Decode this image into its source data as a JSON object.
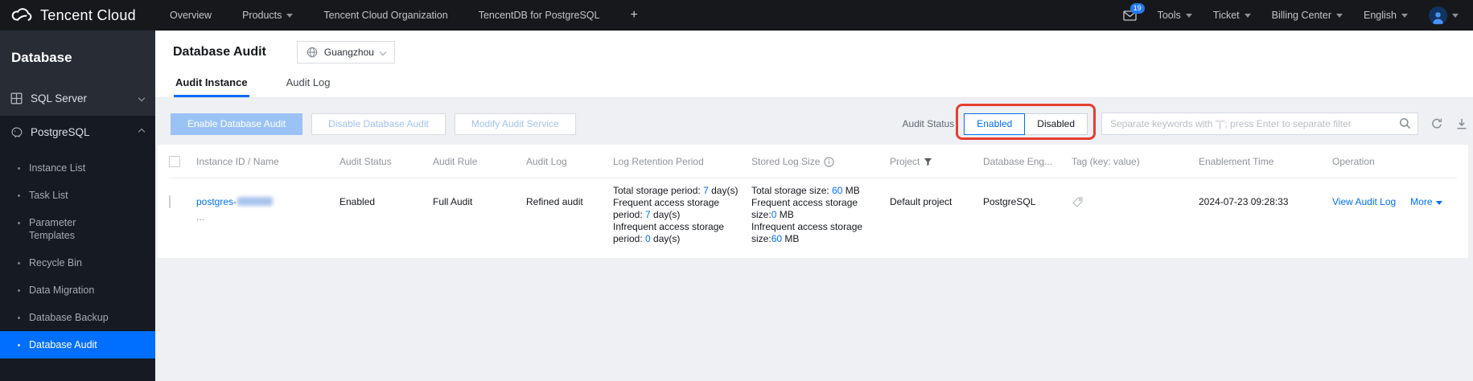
{
  "topbar": {
    "brand": "Tencent Cloud",
    "nav": [
      {
        "label": "Overview",
        "arrow": false
      },
      {
        "label": "Products",
        "arrow": true
      },
      {
        "label": "Tencent Cloud Organization",
        "arrow": false
      },
      {
        "label": "TencentDB for PostgreSQL",
        "arrow": false
      },
      {
        "label": "+",
        "arrow": false
      }
    ],
    "mail_badge": "19",
    "right_nav": [
      {
        "label": "Tools",
        "arrow": true
      },
      {
        "label": "Ticket",
        "arrow": true
      },
      {
        "label": "Billing Center",
        "arrow": true
      },
      {
        "label": "English",
        "arrow": true
      }
    ]
  },
  "sidebar": {
    "title": "Database",
    "groups": [
      {
        "label": "SQL Server"
      },
      {
        "label": "PostgreSQL"
      }
    ],
    "items": [
      {
        "label": "Instance List"
      },
      {
        "label": "Task List"
      },
      {
        "label": "Parameter Templates"
      },
      {
        "label": "Recycle Bin"
      },
      {
        "label": "Data Migration"
      },
      {
        "label": "Database Backup"
      },
      {
        "label": "Database Audit"
      }
    ],
    "selected_item": "Database Audit"
  },
  "page": {
    "title": "Database Audit",
    "region": "Guangzhou",
    "tabs": [
      {
        "label": "Audit Instance"
      },
      {
        "label": "Audit Log"
      }
    ]
  },
  "toolbar": {
    "enable_button": "Enable Database Audit",
    "disable_button": "Disable Database Audit",
    "modify_button": "Modify Audit Service",
    "audit_status_label": "Audit Status",
    "status_enabled": "Enabled",
    "status_disabled": "Disabled",
    "search_placeholder": "Separate keywords with \"|\"; press Enter to separate filter"
  },
  "table": {
    "columns": [
      "Instance ID / Name",
      "Audit Status",
      "Audit Rule",
      "Audit Log",
      "Log Retention Period",
      "Stored Log Size",
      "Project",
      "Database Eng...",
      "Tag (key: value)",
      "Enablement Time",
      "Operation"
    ],
    "row": {
      "instance_id": "postgres-",
      "instance_name": "...",
      "audit_status": "Enabled",
      "audit_rule": "Full Audit",
      "audit_log": "Refined audit",
      "log_retention_lines": [
        [
          {
            "t": "Total storage period: "
          },
          {
            "t": "7",
            "hl": true
          },
          {
            "t": " day(s)"
          }
        ],
        [
          {
            "t": "Frequent access storage period: "
          },
          {
            "t": "7",
            "hl": true
          },
          {
            "t": " day(s)"
          }
        ],
        [
          {
            "t": "Infrequent access storage period: "
          },
          {
            "t": "0",
            "hl": true
          },
          {
            "t": " day(s)"
          }
        ]
      ],
      "stored_log_lines": [
        [
          {
            "t": "Total storage size: "
          },
          {
            "t": "60",
            "hl": true
          },
          {
            "t": " MB"
          }
        ],
        [
          {
            "t": "Frequent access storage size:"
          },
          {
            "t": "0",
            "hl": true
          },
          {
            "t": " MB"
          }
        ],
        [
          {
            "t": "Infrequent access storage size:"
          },
          {
            "t": "60",
            "hl": true
          },
          {
            "t": " MB"
          }
        ]
      ],
      "project": "Default project",
      "database_engine": "PostgreSQL",
      "enablement_time": "2024-07-23 09:28:33",
      "op_view": "View Audit Log",
      "op_more": "More"
    }
  },
  "colors": {
    "accent_blue": "#006eff",
    "annotation_red": "#e63e31",
    "selected_nav_bg": "#006eff"
  }
}
